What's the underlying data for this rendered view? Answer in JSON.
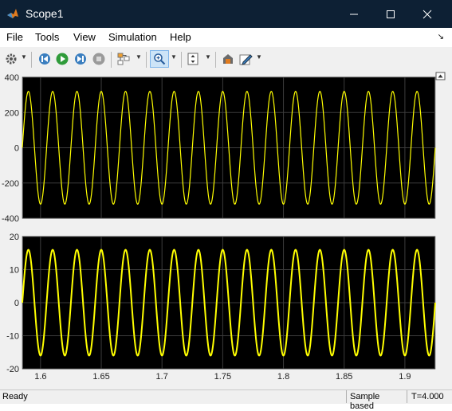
{
  "window": {
    "title": "Scope1"
  },
  "menu": {
    "items": [
      "File",
      "Tools",
      "View",
      "Simulation",
      "Help"
    ]
  },
  "toolbar": {
    "buttons": [
      "gear-icon",
      "step-back-icon",
      "run-icon",
      "step-forward-icon",
      "stop-icon",
      "layout-icon",
      "zoom-icon",
      "fit-icon",
      "style-icon",
      "edit-icon"
    ]
  },
  "colors": {
    "signal": "#ffff00",
    "plot_bg": "#000000",
    "grid": "#3c3c3c",
    "chrome": "#0d2034"
  },
  "chart_data": [
    {
      "type": "line",
      "title": "",
      "xlabel": "",
      "ylabel": "",
      "xlim": [
        1.585,
        1.925
      ],
      "ylim": [
        -400,
        400
      ],
      "yticks": [
        "400",
        "200",
        "0",
        "-200",
        "-400"
      ],
      "grid": true,
      "series": [
        {
          "amplitude": 320,
          "frequency_hz": 50,
          "phase_deg": -90
        }
      ]
    },
    {
      "type": "line",
      "title": "",
      "xlabel": "",
      "ylabel": "",
      "xlim": [
        1.585,
        1.925
      ],
      "ylim": [
        -20,
        20
      ],
      "yticks": [
        "20",
        "10",
        "0",
        "-10",
        "-20"
      ],
      "xticks": [
        "1.6",
        "1.65",
        "1.7",
        "1.75",
        "1.8",
        "1.85",
        "1.9"
      ],
      "grid": true,
      "series": [
        {
          "amplitude": 16,
          "frequency_hz": 50,
          "phase_deg": -90
        }
      ]
    }
  ],
  "status": {
    "ready": "Ready",
    "mode": "Sample based",
    "time": "T=4.000"
  }
}
